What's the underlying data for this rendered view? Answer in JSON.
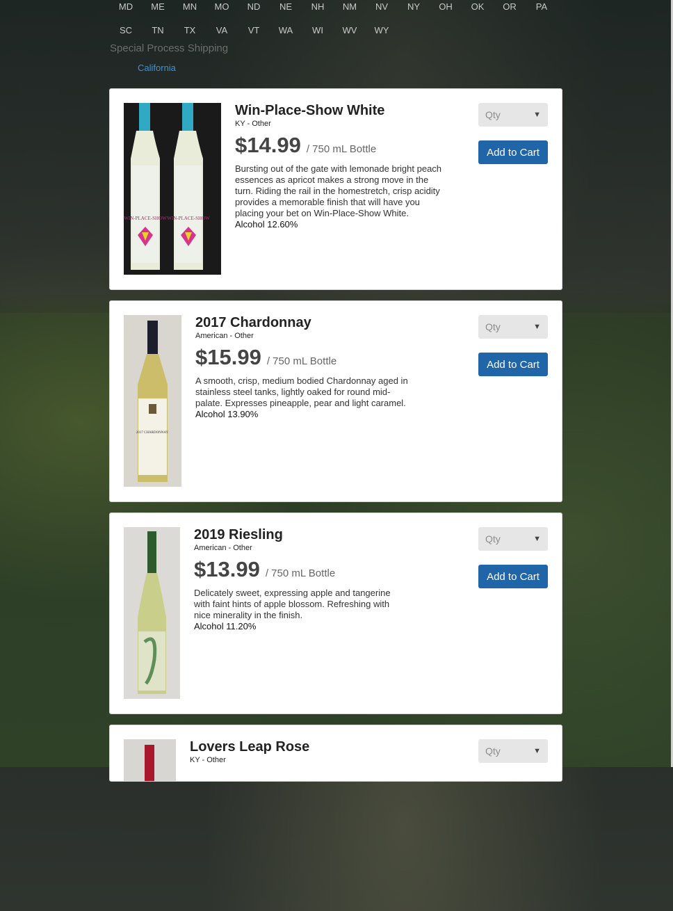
{
  "states": {
    "row1": [
      "MD",
      "ME",
      "MN",
      "MO",
      "ND",
      "NE",
      "NH",
      "NM",
      "NV",
      "NY",
      "OH",
      "OK",
      "OR",
      "PA"
    ],
    "row2": [
      "SC",
      "TN",
      "TX",
      "VA",
      "VT",
      "WA",
      "WI",
      "WV",
      "WY"
    ]
  },
  "special_shipping": {
    "title": "Special Process Shipping",
    "link": "California"
  },
  "qty_placeholder": "Qty",
  "add_to_cart_label": "Add to Cart",
  "products": [
    {
      "name": "Win-Place-Show White",
      "origin": "KY - Other",
      "price": "$14.99",
      "unit": "/ 750 mL Bottle",
      "description": "Bursting out of the gate with lemonade bright peach essences as apricot makes a strong move in the turn. Riding the rail in the homestretch, crisp acidity provides a memorable finish that will have you placing your bet on Win-Place-Show White.",
      "alcohol": "Alcohol 12.60%",
      "label_text": "WIN-PLACE-SHOW"
    },
    {
      "name": "2017 Chardonnay",
      "origin": "American - Other",
      "price": "$15.99",
      "unit": "/ 750 mL Bottle",
      "description": "A smooth, crisp, medium bodied Chardonnay aged in stainless steel tanks, lightly oaked for round mid-palate. Expresses pineapple, pear and light caramel.",
      "alcohol": "Alcohol 13.90%",
      "label_text": "2017 CHARDONNAY"
    },
    {
      "name": "2019 Riesling",
      "origin": "American - Other",
      "price": "$13.99",
      "unit": "/ 750 mL Bottle",
      "description": "Delicately sweet, expressing apple and tangerine with faint hints of apple blossom. Refreshing with nice minerality in the finish.",
      "alcohol": "Alcohol 11.20%"
    },
    {
      "name": "Lovers Leap Rose",
      "origin": "KY - Other"
    }
  ],
  "colors": {
    "button_blue": "#1f65a8",
    "link_blue": "#3c93d6",
    "card_bg": "#ffffff"
  }
}
